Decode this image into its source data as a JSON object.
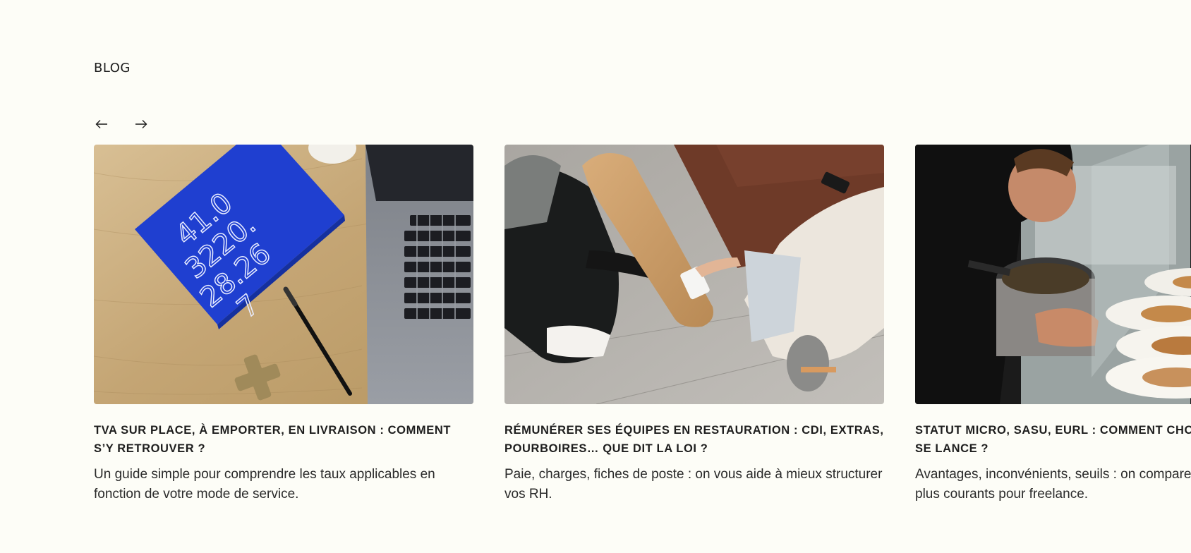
{
  "section": {
    "label": "BLOG"
  },
  "navigation": {
    "prev_icon": "arrow-left-icon",
    "next_icon": "arrow-right-icon"
  },
  "cards": [
    {
      "image": "blue-notebook-laptop-photo",
      "title": "TVA SUR PLACE, À EMPORTER, EN LIVRAISON : COMMENT S’Y RETROUVER ?",
      "excerpt": "Un guide simple pour comprendre les taux applicables en fonction de votre mode de service."
    },
    {
      "image": "payment-terminal-photo",
      "title": "RÉMUNÉRER SES ÉQUIPES EN RESTAURATION : CDI, EXTRAS, POURBOIRES… QUE DIT LA LOI ?",
      "excerpt": "Paie, charges, fiches de poste : on vous aide à mieux structurer vos RH."
    },
    {
      "image": "chef-plating-photo",
      "title": "STATUT MICRO, SASU, EURL : COMMENT CHOI SE LANCE ?",
      "title_line1": "STATUT MICRO, SASU, EURL : COMMENT CHOI",
      "title_line2": "SE LANCE ?",
      "excerpt_line1": "Avantages, inconvénients, seuils : on compare",
      "excerpt_line2": "plus courants pour freelance."
    }
  ],
  "notebook_text": "41.03220.28.267",
  "colors": {
    "background": "#fdfdf7",
    "text": "#222222",
    "notebook_blue": "#1f3fd0",
    "wood": "#c8aa7c"
  }
}
